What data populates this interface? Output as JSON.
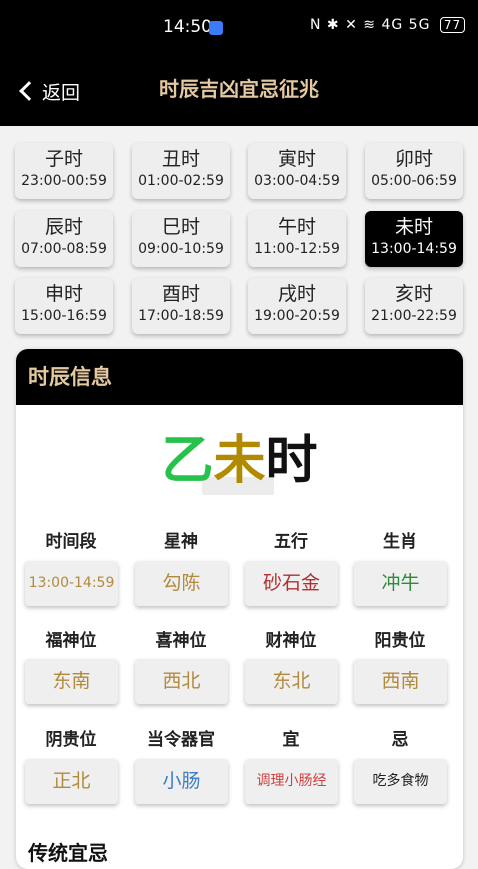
{
  "status_bar": {
    "time": "14:50",
    "icons_text": "N ✱ ✕ ≋ 4G 5G",
    "battery": "77"
  },
  "nav": {
    "back_label": "返回",
    "title": "时辰吉凶宜忌征兆"
  },
  "hours": [
    {
      "name": "子时",
      "range": "23:00-00:59"
    },
    {
      "name": "丑时",
      "range": "01:00-02:59"
    },
    {
      "name": "寅时",
      "range": "03:00-04:59"
    },
    {
      "name": "卯时",
      "range": "05:00-06:59"
    },
    {
      "name": "辰时",
      "range": "07:00-08:59"
    },
    {
      "name": "巳时",
      "range": "09:00-10:59"
    },
    {
      "name": "午时",
      "range": "11:00-12:59"
    },
    {
      "name": "未时",
      "range": "13:00-14:59",
      "selected": true
    },
    {
      "name": "申时",
      "range": "15:00-16:59"
    },
    {
      "name": "酉时",
      "range": "17:00-18:59"
    },
    {
      "name": "戌时",
      "range": "19:00-20:59"
    },
    {
      "name": "亥时",
      "range": "21:00-22:59"
    }
  ],
  "info": {
    "header": "时辰信息",
    "title_parts": [
      "乙",
      "未",
      "时"
    ],
    "attributes": [
      {
        "label": "时间段",
        "value": "13:00-14:59",
        "color": "#b08a3e"
      },
      {
        "label": "星神",
        "value": "勾陈",
        "color": "#b08a3e"
      },
      {
        "label": "五行",
        "value": "砂石金",
        "color": "#b03030"
      },
      {
        "label": "生肖",
        "value": "冲牛",
        "color": "#2e8b3a"
      },
      {
        "label": "福神位",
        "value": "东南",
        "color": "#b08a3e"
      },
      {
        "label": "喜神位",
        "value": "西北",
        "color": "#b08a3e"
      },
      {
        "label": "财神位",
        "value": "东北",
        "color": "#b08a3e"
      },
      {
        "label": "阳贵位",
        "value": "西南",
        "color": "#b08a3e"
      },
      {
        "label": "阴贵位",
        "value": "正北",
        "color": "#b08a3e"
      },
      {
        "label": "当令器官",
        "value": "小肠",
        "color": "#3a7fc4"
      },
      {
        "label": "宜",
        "value": "调理小肠经",
        "color": "#d04040"
      },
      {
        "label": "忌",
        "value": "吃多食物",
        "color": "#222222"
      }
    ],
    "next_section_title": "传统宜忌"
  }
}
